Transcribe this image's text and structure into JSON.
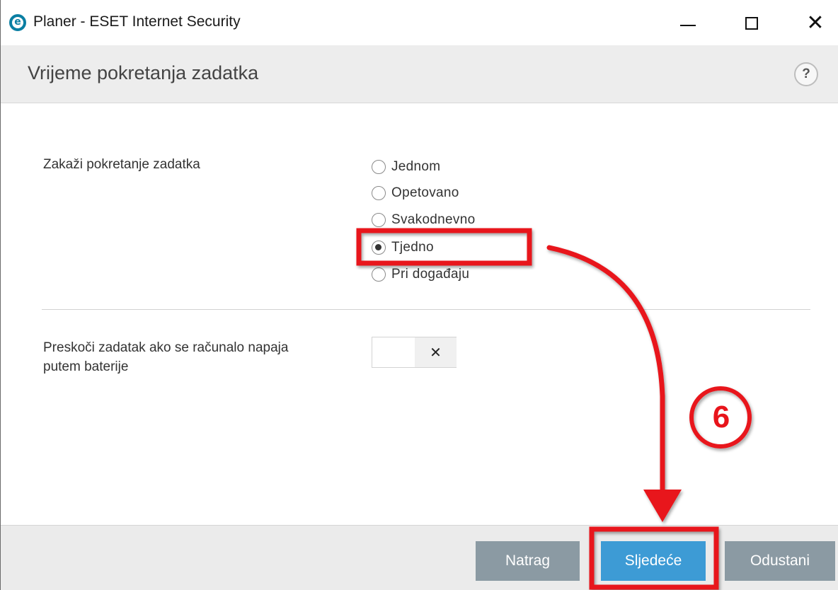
{
  "window": {
    "icon_letter": "e",
    "title": "Planer - ESET Internet Security"
  },
  "header": {
    "title": "Vrijeme pokretanja zadatka",
    "help_symbol": "?"
  },
  "schedule": {
    "label": "Zakaži pokretanje zadatka",
    "options": [
      {
        "label": "Jednom",
        "checked": false
      },
      {
        "label": "Opetovano",
        "checked": false
      },
      {
        "label": "Svakodnevno",
        "checked": false
      },
      {
        "label": "Tjedno",
        "checked": true
      },
      {
        "label": "Pri događaju",
        "checked": false
      }
    ]
  },
  "battery": {
    "label_line1": "Preskoči zadatak ako se računalo napaja",
    "label_line2": "putem baterije",
    "toggle_symbol": "✕",
    "enabled": false
  },
  "footer": {
    "back_label": "Natrag",
    "next_label": "Sljedeće",
    "cancel_label": "Odustani"
  },
  "annotation": {
    "step_number": "6",
    "color": "#e8141b"
  },
  "colors": {
    "primary_button": "#3d9bd5",
    "secondary_button": "#8b9aa3",
    "header_bg": "#ededed",
    "brand": "#0b7fa3"
  }
}
